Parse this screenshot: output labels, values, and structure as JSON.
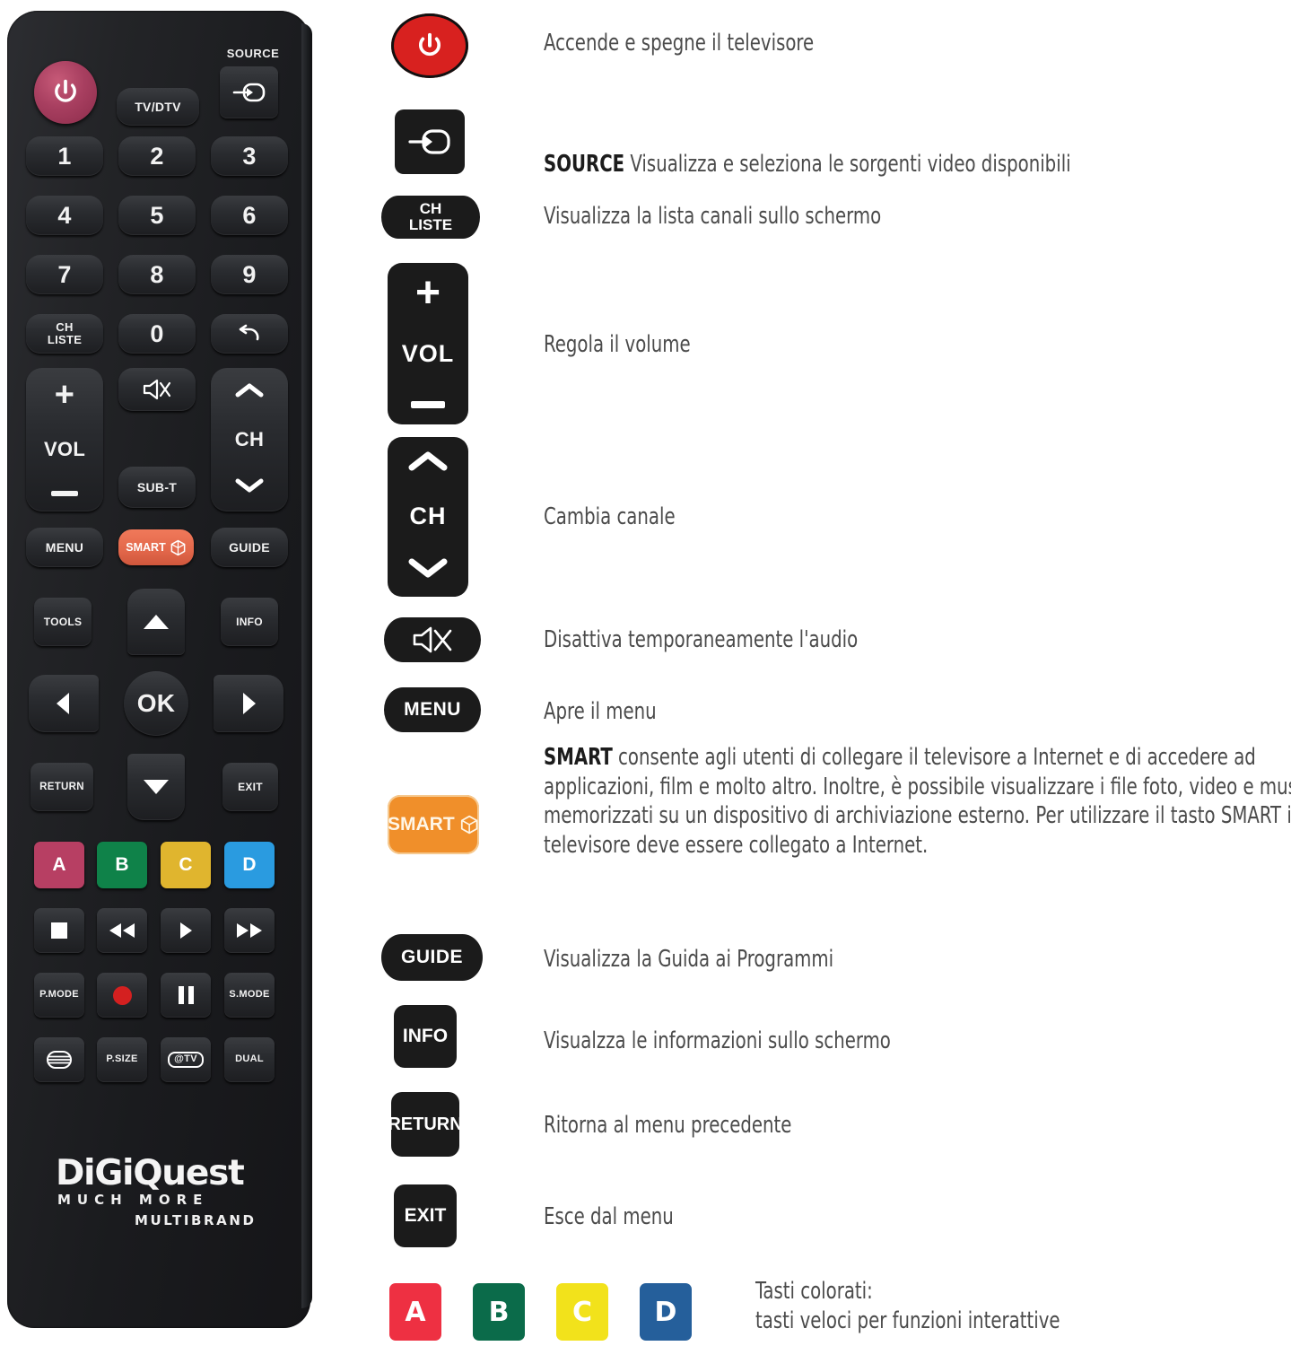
{
  "remote": {
    "brand": {
      "name": "DiGiQuest",
      "tagline": "MUCH MORE",
      "sub": "MULTIBRAND"
    },
    "source_label": "SOURCE",
    "buttons": {
      "tv_dtv": "TV/DTV",
      "n1": "1",
      "n2": "2",
      "n3": "3",
      "n4": "4",
      "n5": "5",
      "n6": "6",
      "n7": "7",
      "n8": "8",
      "n9": "9",
      "n0": "0",
      "ch_liste": "CH\nLISTE",
      "vol": "VOL",
      "ch": "CH",
      "sub_t": "SUB-T",
      "menu": "MENU",
      "smart": "SMART",
      "guide": "GUIDE",
      "tools": "TOOLS",
      "info": "INFO",
      "ok": "OK",
      "return": "RETURN",
      "exit": "EXIT",
      "a": "A",
      "b": "B",
      "c": "C",
      "d": "D",
      "p_mode": "P.MODE",
      "s_mode": "S.MODE",
      "p_size": "P.SIZE",
      "at_tv": "@TV",
      "dual": "DUAL"
    },
    "colors": {
      "power": "#a83f60",
      "smart": "#e2674a",
      "a": "#b73f63",
      "b": "#0f8249",
      "c": "#e0b52e",
      "d": "#2a9be0",
      "record": "#d42020"
    }
  },
  "legend": {
    "items": [
      {
        "id": "power",
        "icon": "power-icon",
        "text": "Accende e spegne il televisore",
        "bold": ""
      },
      {
        "id": "source",
        "icon": "source-icon",
        "text": " Visualizza e seleziona le sorgenti video disponibili",
        "bold": "SOURCE"
      },
      {
        "id": "chliste",
        "icon": "ch-liste-icon",
        "label": "CH\nLISTE",
        "text": "Visualizza la lista canali sullo schermo",
        "bold": ""
      },
      {
        "id": "vol",
        "icon": "volume-icon",
        "label": "VOL",
        "text": "Regola il volume",
        "bold": ""
      },
      {
        "id": "ch",
        "icon": "channel-icon",
        "label": "CH",
        "text": "Cambia canale",
        "bold": ""
      },
      {
        "id": "mute",
        "icon": "mute-icon",
        "text": "Disattiva temporaneamente l'audio",
        "bold": ""
      },
      {
        "id": "menu",
        "icon": "menu-icon",
        "label": "MENU",
        "text": "Apre il menu",
        "bold": ""
      },
      {
        "id": "smart",
        "icon": "smart-icon",
        "label": "SMART",
        "bold": "SMART",
        "text": " consente agli utenti di collegare il televisore a Internet e di accedere ad applicazioni, film e molto altro. Inoltre, è possibile visualizzare i file foto, video e musica memorizzati su un dispositivo di archiviazione esterno. Per utilizzare il tasto SMART il televisore deve essere collegato a Internet."
      },
      {
        "id": "guide",
        "icon": "guide-icon",
        "label": "GUIDE",
        "text": "Visualizza la Guida ai Programmi",
        "bold": ""
      },
      {
        "id": "info",
        "icon": "info-icon",
        "label": "INFO",
        "text": "Visualzza le informazioni sullo schermo",
        "bold": ""
      },
      {
        "id": "return",
        "icon": "return-icon",
        "label": "RETURN",
        "text": "Ritorna al menu precedente",
        "bold": ""
      },
      {
        "id": "exit",
        "icon": "exit-icon",
        "label": "EXIT",
        "text": "Esce dal menu",
        "bold": ""
      },
      {
        "id": "colorkeys",
        "icon": "color-keys-icon",
        "text": "Tasti colorati:\ntasti veloci per funzioni interattive",
        "bold": ""
      }
    ],
    "color_keys": [
      {
        "label": "A",
        "color": "#ee3042"
      },
      {
        "label": "B",
        "color": "#0b6b4a"
      },
      {
        "label": "C",
        "color": "#f2e21b"
      },
      {
        "label": "D",
        "color": "#255f9b"
      }
    ],
    "smart_icon_color": "#f08f2a"
  }
}
